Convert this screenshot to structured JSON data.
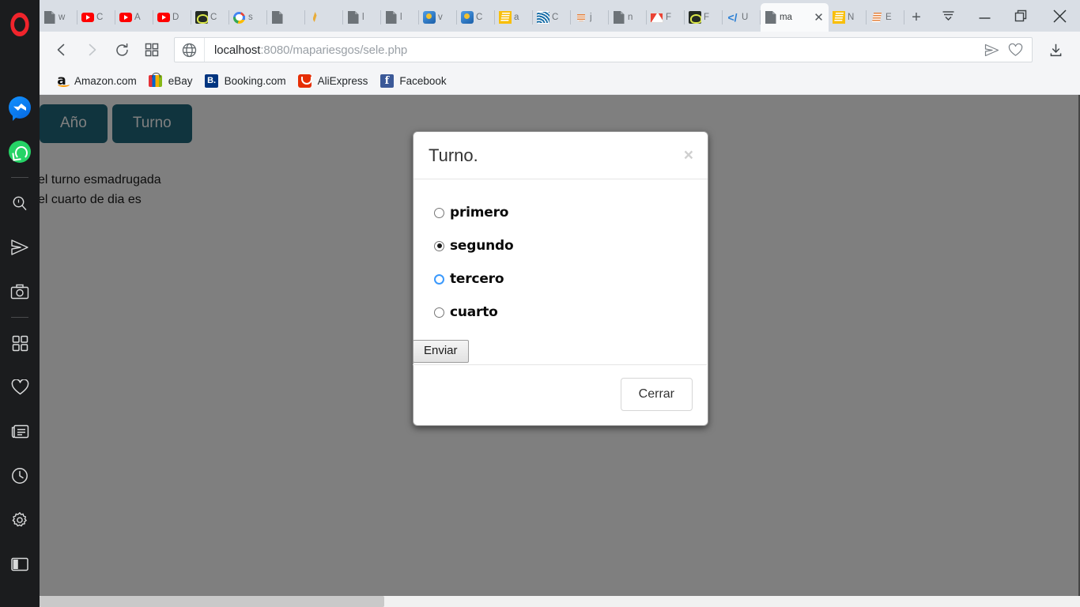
{
  "browser": {
    "name": "opera",
    "sidebar": {
      "items": [
        {
          "name": "opera-logo",
          "icon": "opera-icon"
        },
        {
          "name": "messenger",
          "icon": "messenger-icon"
        },
        {
          "name": "whatsapp",
          "icon": "whatsapp-icon"
        },
        {
          "name": "search",
          "icon": "search-icon"
        },
        {
          "name": "telegram",
          "icon": "send-icon"
        },
        {
          "name": "snapshot",
          "icon": "camera-icon"
        },
        {
          "name": "workspaces",
          "icon": "grid-icon"
        },
        {
          "name": "favorites",
          "icon": "heart-icon"
        },
        {
          "name": "news",
          "icon": "news-icon"
        },
        {
          "name": "history",
          "icon": "clock-icon"
        },
        {
          "name": "settings",
          "icon": "gear-icon"
        },
        {
          "name": "panel-toggle",
          "icon": "sidebar-panel-icon"
        }
      ]
    },
    "tabs": [
      {
        "title": "w",
        "favicon": "fav-doc",
        "active": false
      },
      {
        "title": "C",
        "favicon": "fav-yt",
        "active": false
      },
      {
        "title": "A",
        "favicon": "fav-yt",
        "active": false
      },
      {
        "title": "D",
        "favicon": "fav-yt",
        "active": false
      },
      {
        "title": "C",
        "favicon": "fav-dark",
        "active": false
      },
      {
        "title": "s",
        "favicon": "fav-google",
        "active": false
      },
      {
        "title": "",
        "favicon": "fav-doc",
        "active": false
      },
      {
        "title": "",
        "favicon": "fav-quill",
        "active": false
      },
      {
        "title": "l",
        "favicon": "fav-doc",
        "active": false
      },
      {
        "title": "l",
        "favicon": "fav-doc",
        "active": false
      },
      {
        "title": "v",
        "favicon": "fav-vbox",
        "active": false
      },
      {
        "title": "C",
        "favicon": "fav-vbox",
        "active": false
      },
      {
        "title": "a",
        "favicon": "fav-java",
        "active": false
      },
      {
        "title": "C",
        "favicon": "fav-jquery",
        "active": false
      },
      {
        "title": "j",
        "favicon": "fav-javacup",
        "active": false
      },
      {
        "title": "n",
        "favicon": "fav-doc",
        "active": false
      },
      {
        "title": "F",
        "favicon": "fav-gmail",
        "active": false
      },
      {
        "title": "F",
        "favicon": "fav-dark",
        "active": false
      },
      {
        "title": "U",
        "favicon": "fav-code",
        "active": false
      },
      {
        "title": "ma",
        "favicon": "fav-doc",
        "active": true
      },
      {
        "title": "N",
        "favicon": "fav-stack",
        "active": false
      },
      {
        "title": "E",
        "favicon": "fav-stackg",
        "active": false
      }
    ],
    "new_tab_label": "+",
    "window_controls": {
      "tab_menu": "tab-menu-icon",
      "minimize": "minimize-icon",
      "restore": "restore-icon",
      "close": "close-icon"
    },
    "toolbar": {
      "back": "back-icon",
      "forward": "forward-icon",
      "reload": "reload-icon",
      "speed_dial": "grid-icon",
      "url_host": "localhost",
      "url_rest": ":8080/mapariesgos/sele.php",
      "url_full": "localhost:8080/mapariesgos/sele.php",
      "share": "send-icon",
      "bookmark": "heart-icon",
      "downloads": "download-icon"
    },
    "bookmarks": [
      {
        "label": "Amazon.com",
        "icon": "amazon-icon"
      },
      {
        "label": "eBay",
        "icon": "ebay-icon"
      },
      {
        "label": "Booking.com",
        "icon": "booking-icon",
        "glyph": "B."
      },
      {
        "label": "AliExpress",
        "icon": "aliexpress-icon"
      },
      {
        "label": "Facebook",
        "icon": "facebook-icon",
        "glyph": "f"
      }
    ]
  },
  "page": {
    "buttons": [
      {
        "label": "Año"
      },
      {
        "label": "Turno"
      }
    ],
    "lines": [
      "el turno esmadrugada",
      "el cuarto de dia es"
    ],
    "accent_color": "#20697c"
  },
  "modal": {
    "title": "Turno.",
    "close_x": "×",
    "options": [
      {
        "label": "primero",
        "checked": false,
        "focused": false
      },
      {
        "label": "segundo",
        "checked": true,
        "focused": false
      },
      {
        "label": "tercero",
        "checked": false,
        "focused": true
      },
      {
        "label": "cuarto",
        "checked": false,
        "focused": false
      }
    ],
    "submit_label": "Enviar",
    "close_label": "Cerrar"
  }
}
